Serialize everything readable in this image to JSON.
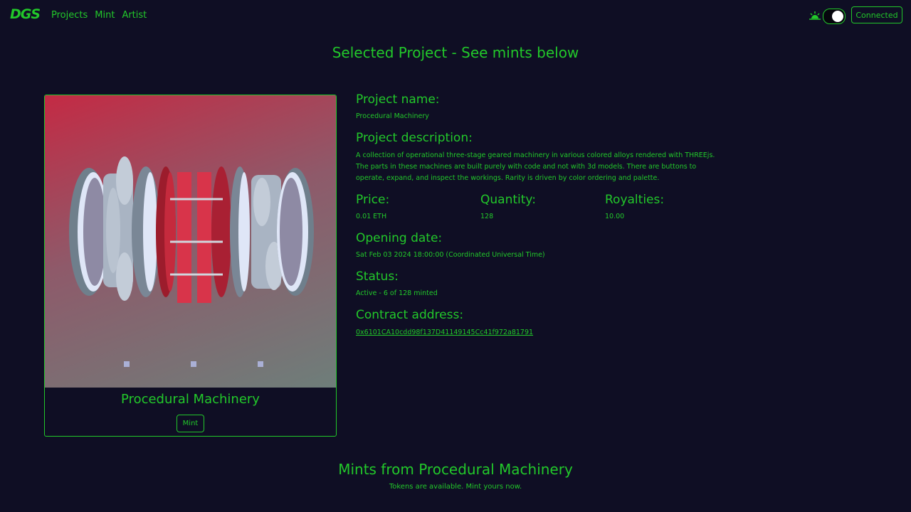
{
  "nav": {
    "logo": "DGS",
    "links": [
      "Projects",
      "Mint",
      "Artist"
    ],
    "connected_label": "Connected"
  },
  "page_title": "Selected Project - See mints below",
  "card": {
    "title": "Procedural Machinery",
    "mint_label": "Mint"
  },
  "info": {
    "name_label": "Project name:",
    "name": "Procedural Machinery",
    "description_label": "Project description:",
    "description": "A collection of operational three-stage geared machinery in various colored alloys rendered with THREEjs. The parts in these machines are built purely with code and not with 3d models. There are buttons to operate, expand, and inspect the workings. Rarity is driven by color ordering and palette.",
    "price_label": "Price:",
    "price": "0.01 ETH",
    "quantity_label": "Quantity:",
    "quantity": "128",
    "royalties_label": "Royalties:",
    "royalties": "10.00",
    "opening_label": "Opening date:",
    "opening": "Sat Feb 03 2024 18:00:00 (Coordinated Universal Time)",
    "status_label": "Status:",
    "status": "Active - 6 of 128 minted",
    "contract_label": "Contract address:",
    "contract": "0x6101CA10cdd98f137D41149145Cc41f972a81791"
  },
  "mints": {
    "title": "Mints from Procedural Machinery",
    "subtitle": "Tokens are available. Mint yours now."
  },
  "colors": {
    "background": "#0f0e24",
    "accent": "#22c82a"
  }
}
